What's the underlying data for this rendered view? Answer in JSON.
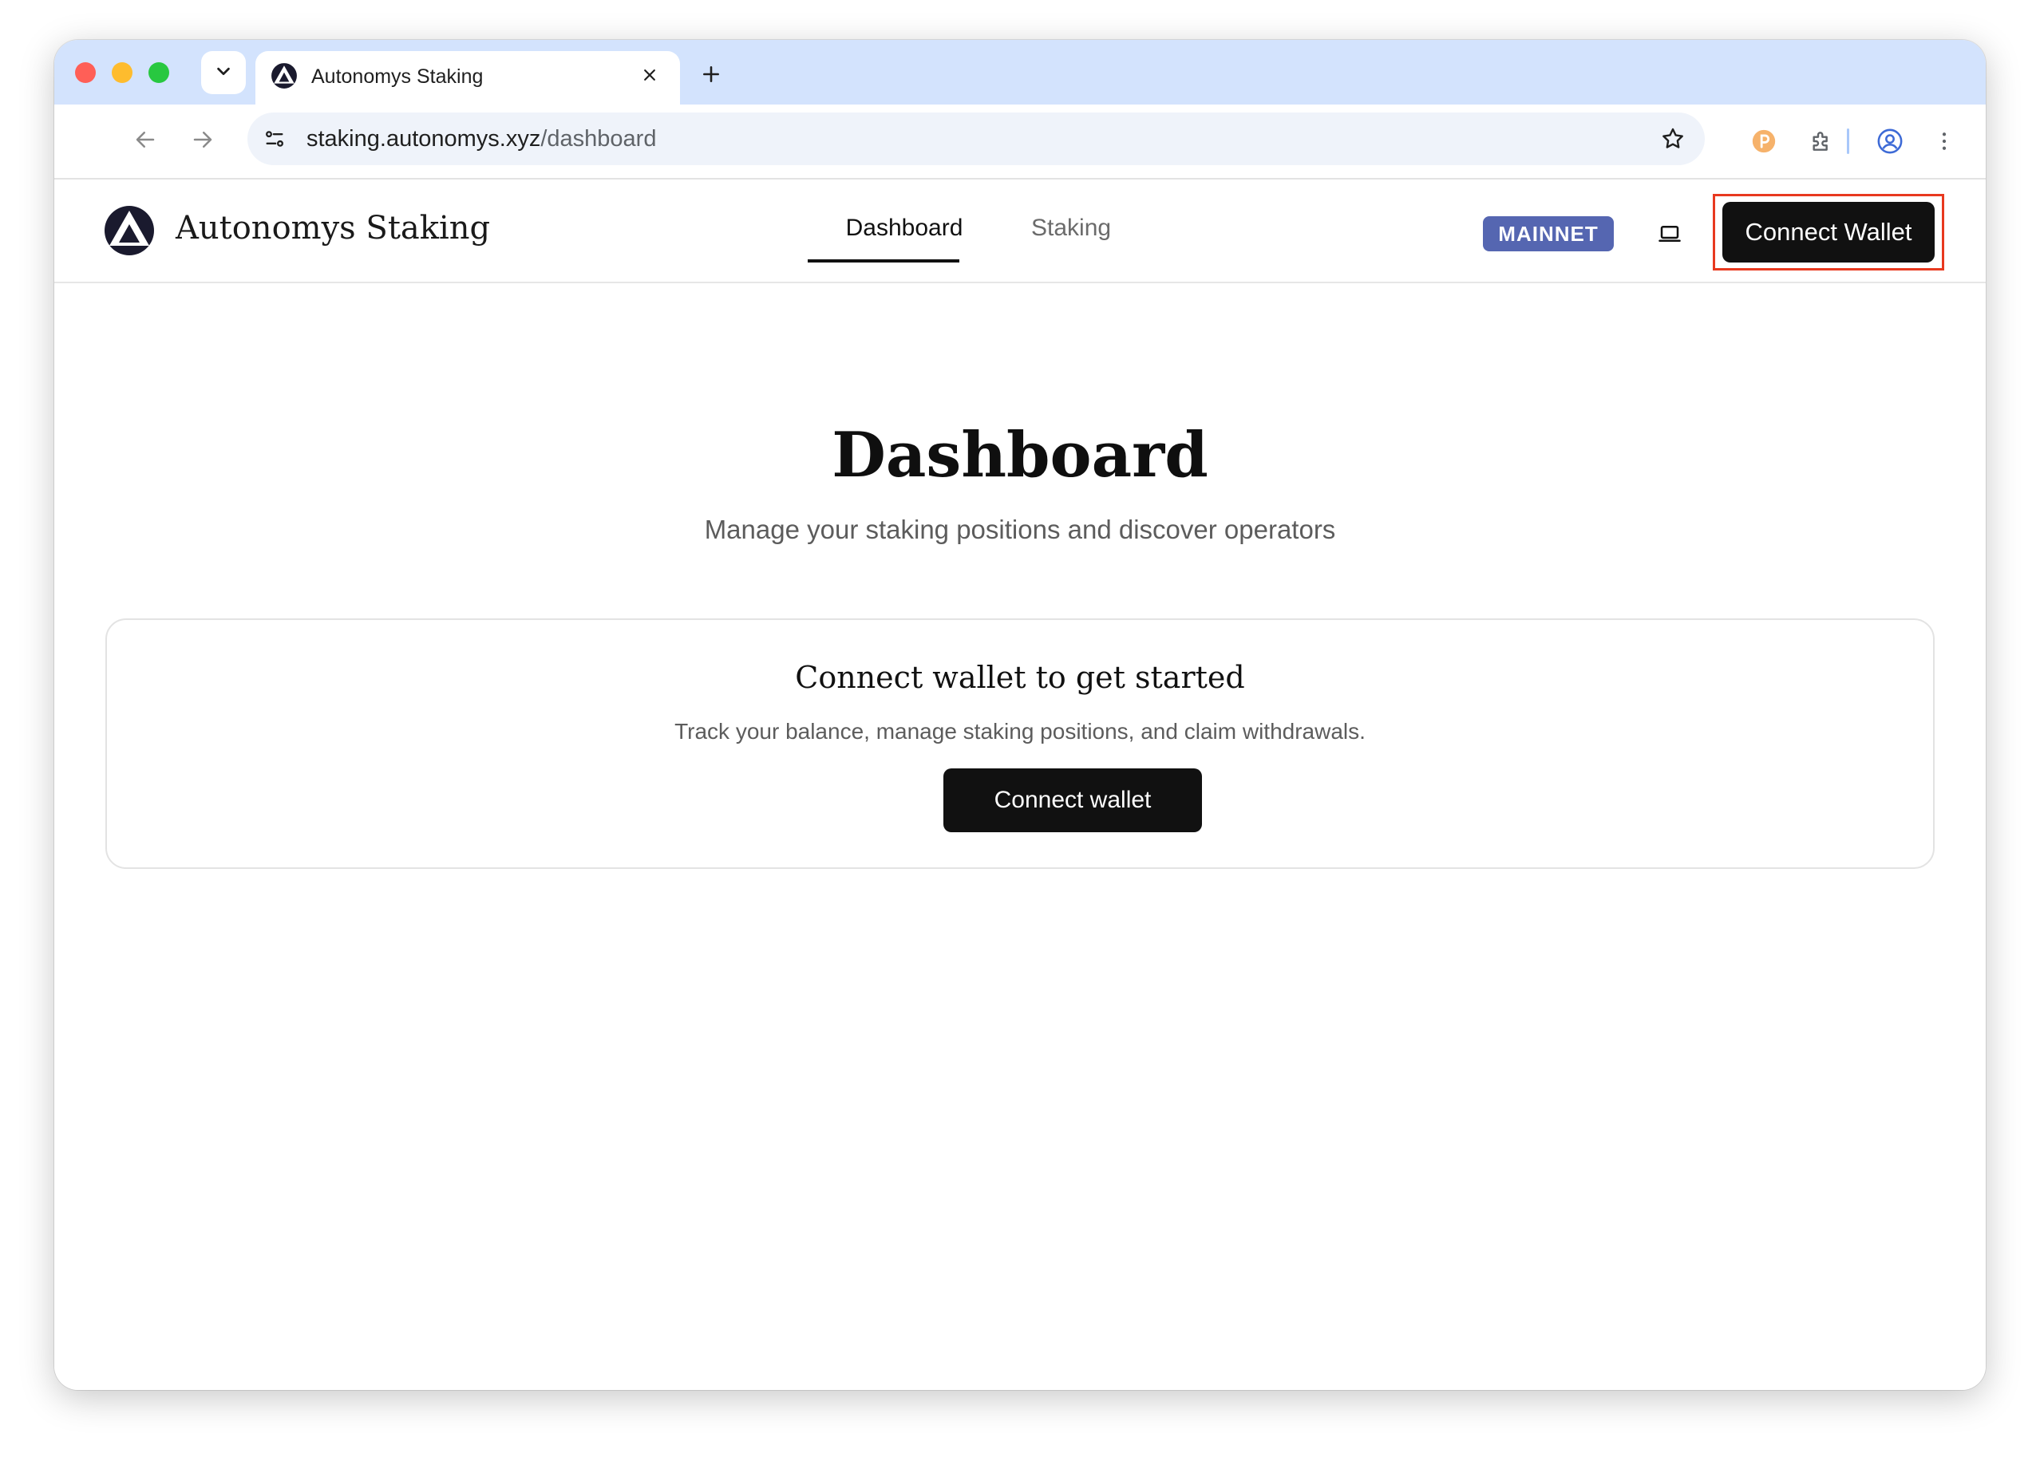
{
  "browser": {
    "tab": {
      "title": "Autonomys Staking",
      "favicon": "autonomys-logo-icon"
    },
    "url": {
      "host": "staking.autonomys.xyz",
      "path": "/dashboard"
    },
    "icons": [
      "back-arrow-icon",
      "forward-arrow-icon",
      "reload-icon",
      "site-info-icon",
      "star-icon",
      "extension-coin-icon",
      "puzzle-icon",
      "profile-icon",
      "more-vert-icon"
    ]
  },
  "header": {
    "brand": "Autonomys Staking",
    "nav": {
      "dashboard": "Dashboard",
      "staking": "Staking"
    },
    "network_badge": "MAINNET",
    "connect_button": "Connect Wallet"
  },
  "main": {
    "title": "Dashboard",
    "subtitle": "Manage your staking positions and discover operators",
    "card": {
      "title": "Connect wallet to get started",
      "text": "Track your balance, manage staking positions, and claim withdrawals.",
      "button": "Connect wallet"
    }
  },
  "colors": {
    "tabstrip": "#d3e3fd",
    "badge": "#5566b1",
    "button": "#111111",
    "highlight": "#e8391f"
  }
}
